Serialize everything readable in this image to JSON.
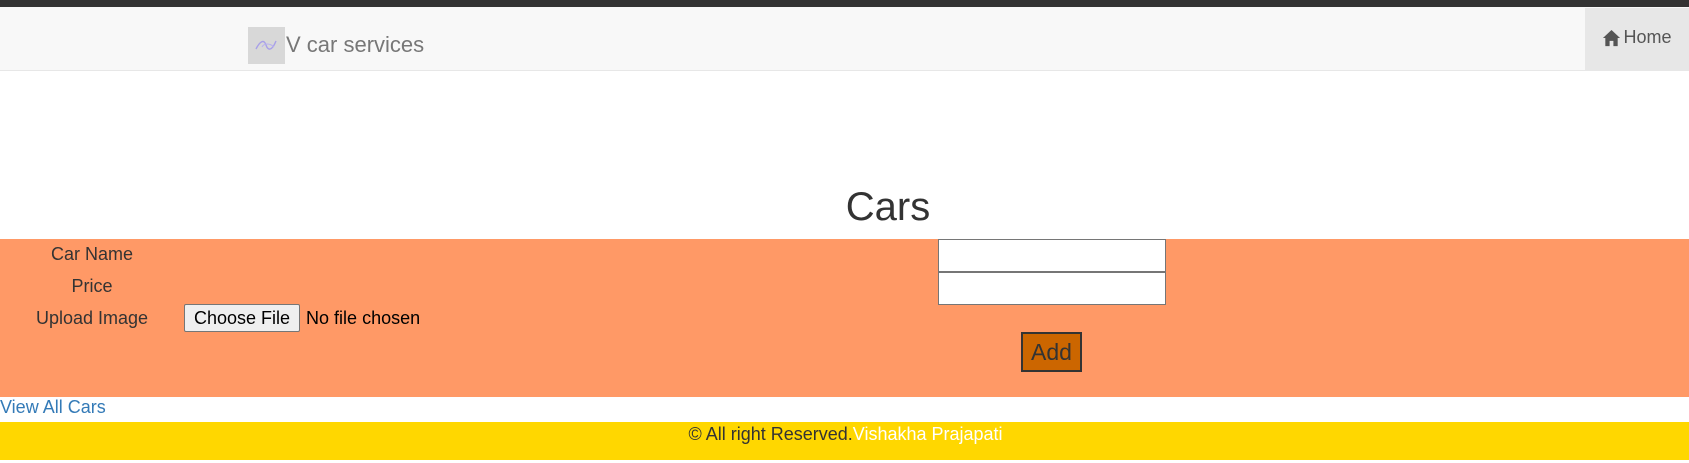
{
  "navbar": {
    "brand_text": "V car services",
    "home_label": "Home"
  },
  "main": {
    "title": "Cars"
  },
  "form": {
    "car_name_label": "Car Name",
    "price_label": "Price",
    "upload_label": "Upload Image",
    "car_name_value": "",
    "price_value": "",
    "choose_file_label": "Choose File",
    "file_status": "No file chosen",
    "add_label": "Add"
  },
  "links": {
    "view_all": "View All Cars"
  },
  "footer": {
    "copyright": "© All right Reserved.",
    "author": "Vishakha Prajapati"
  },
  "colors": {
    "form_background": "#ff9966",
    "add_button": "#cc6600",
    "footer_background": "#ffd700",
    "link": "#337ab7"
  },
  "icons": {
    "logo": "brand-logo-icon",
    "home": "home-icon"
  }
}
